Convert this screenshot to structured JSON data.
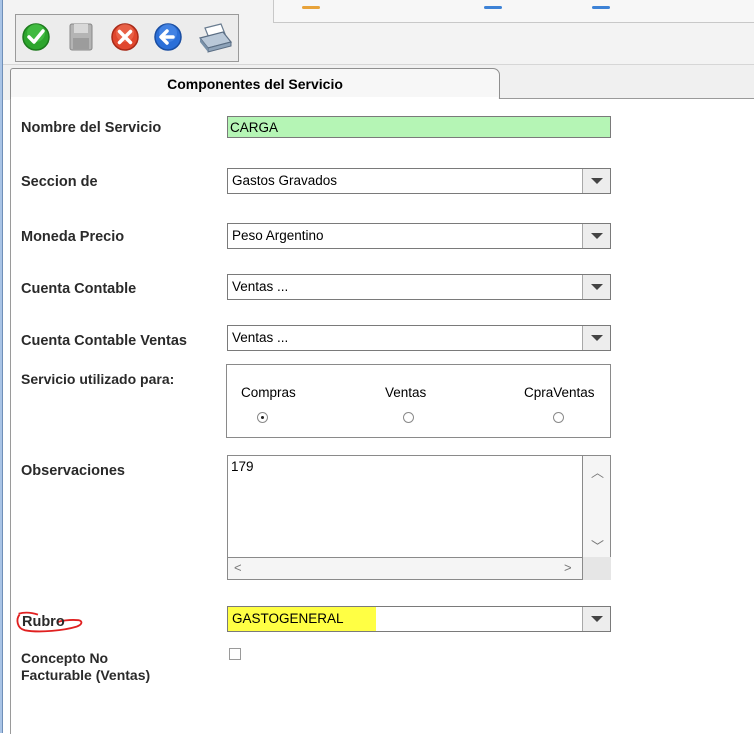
{
  "toolbar": {
    "buttons": [
      {
        "name": "accept",
        "icon": "check-icon",
        "color": "#2da52d"
      },
      {
        "name": "save",
        "icon": "save-icon",
        "color": "#a8a8a8"
      },
      {
        "name": "cancel",
        "icon": "close-icon",
        "color": "#e0472e"
      },
      {
        "name": "back",
        "icon": "back-arrow-icon",
        "color": "#2b6fd8"
      },
      {
        "name": "print",
        "icon": "printer-icon",
        "color": "#7a8fa6"
      }
    ]
  },
  "tab": {
    "label": "Componentes del Servicio"
  },
  "form": {
    "nombre_label": "Nombre del Servicio",
    "nombre_value": "CARGA",
    "seccion_label": "Seccion de",
    "seccion_value": "Gastos Gravados",
    "moneda_label": "Moneda Precio",
    "moneda_value": "Peso Argentino",
    "cuenta_label": "Cuenta Contable",
    "cuenta_value": "Ventas ...",
    "cuenta_ventas_label": "Cuenta Contable Ventas",
    "cuenta_ventas_value": "Ventas ...",
    "servicio_label": "Servicio utilizado para:",
    "radio_options": [
      "Compras",
      "Ventas",
      "CpraVentas"
    ],
    "radio_selected": "Compras",
    "observaciones_label": "Observaciones",
    "observaciones_value": "179",
    "rubro_label": "Rubro",
    "rubro_value": "GASTOGENERAL",
    "concepto_label_line1": "Concepto No",
    "concepto_label_line2": "Facturable (Ventas)",
    "concepto_checked": false
  },
  "colors": {
    "name_field_bg": "#b5f5b5",
    "rubro_highlight": "#ffff44",
    "annotation_red": "#e02020"
  }
}
